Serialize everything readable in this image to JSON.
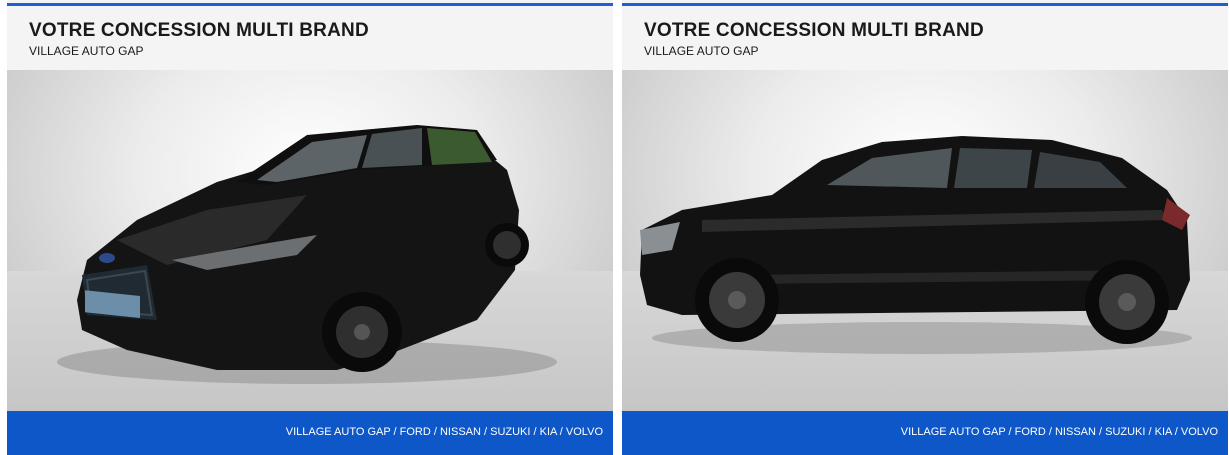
{
  "cards": [
    {
      "title": "VOTRE CONCESSION MULTI BRAND",
      "subtitle": "VILLAGE AUTO GAP",
      "footer": "VILLAGE AUTO GAP / FORD / NISSAN / SUZUKI / KIA / VOLVO",
      "photo_icon": "car-front-three-quarter-icon"
    },
    {
      "title": "VOTRE CONCESSION MULTI BRAND",
      "subtitle": "VILLAGE AUTO GAP",
      "footer": "VILLAGE AUTO GAP / FORD / NISSAN / SUZUKI / KIA / VOLVO",
      "photo_icon": "car-side-view-icon"
    }
  ],
  "colors": {
    "accent_blue": "#0d57c9",
    "top_line": "#1f5fd1",
    "car_body": "#121212"
  }
}
